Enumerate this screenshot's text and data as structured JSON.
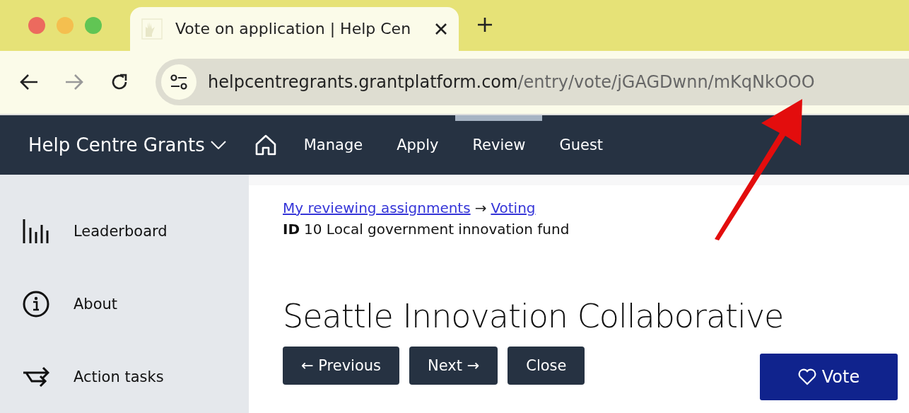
{
  "browser": {
    "tab_title": "Vote on application | Help Cen",
    "url_host": "helpcentregrants.grantplatform.com",
    "url_path": "/entry/vote/jGAGDwnn/mKqNkOOO"
  },
  "navbar": {
    "brand": "Help Centre Grants",
    "items": [
      {
        "label": "Manage",
        "selected": false
      },
      {
        "label": "Apply",
        "selected": false
      },
      {
        "label": "Review",
        "selected": true
      },
      {
        "label": "Guest",
        "selected": false
      }
    ]
  },
  "sidebar": {
    "items": [
      {
        "label": "Leaderboard",
        "kind": "bars"
      },
      {
        "label": "About",
        "kind": "info"
      },
      {
        "label": "Action tasks",
        "kind": "tasks"
      }
    ]
  },
  "breadcrumb": {
    "links": [
      "My reviewing assignments",
      "Voting"
    ],
    "separator": "→"
  },
  "entry": {
    "id_label": "ID",
    "id_text": "10 Local government innovation fund",
    "title": "Seattle Innovation Collaborative"
  },
  "buttons": [
    "← Previous",
    "Next →",
    "Close"
  ],
  "vote_button": "Vote"
}
